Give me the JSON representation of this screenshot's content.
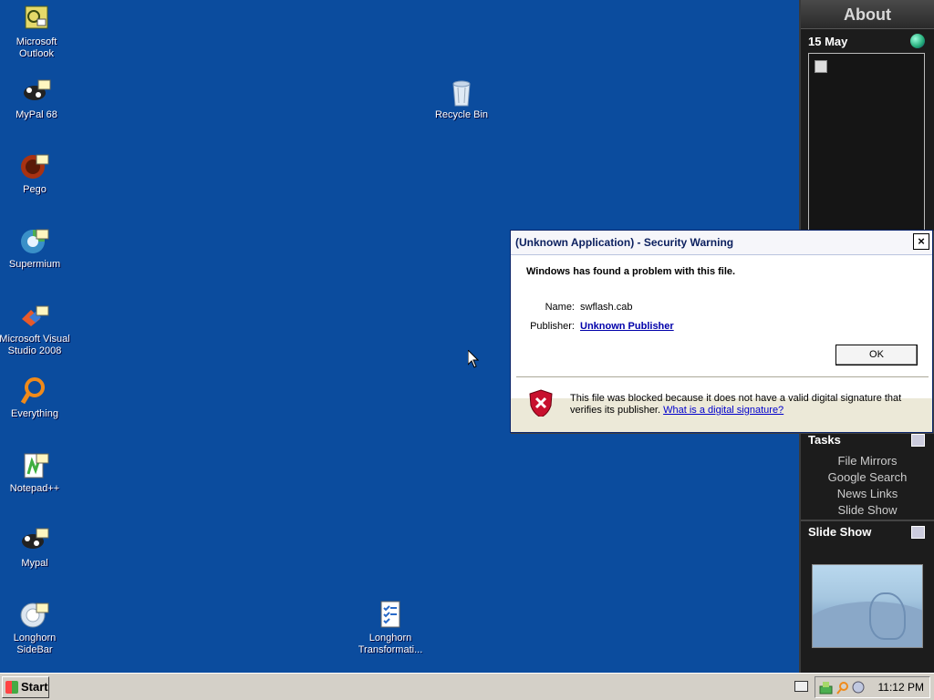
{
  "desktop": {
    "icons": [
      {
        "label": "Microsoft Outlook"
      },
      {
        "label": "MyPal 68"
      },
      {
        "label": "Pego"
      },
      {
        "label": "Supermium"
      },
      {
        "label": "Microsoft Visual Studio 2008"
      },
      {
        "label": "Everything"
      },
      {
        "label": "Notepad++"
      },
      {
        "label": "Mypal"
      },
      {
        "label": "Longhorn SideBar"
      },
      {
        "label": "Recycle Bin"
      },
      {
        "label": "Longhorn Transformati..."
      }
    ]
  },
  "sidebar": {
    "about_label": "About",
    "date": "15 May",
    "tasks": {
      "title": "Tasks",
      "items": [
        "File Mirrors",
        "Google Search",
        "News Links",
        "Slide Show"
      ]
    },
    "slideshow": {
      "title": "Slide Show"
    }
  },
  "dialog": {
    "title": "(Unknown Application) - Security Warning",
    "close_label": "×",
    "warning": "Windows has found a problem with this file.",
    "name_key": "Name:",
    "name_value": "swflash.cab",
    "publisher_key": "Publisher:",
    "publisher_value": "Unknown Publisher",
    "ok_label": "OK",
    "footer_text": "This file was blocked because it does not have a valid digital signature that verifies its publisher.",
    "footer_link": "What is a digital signature?"
  },
  "taskbar": {
    "start_label": "Start",
    "clock": "11:12 PM"
  },
  "icons": {
    "close": "close-icon",
    "shield": "shield-error-icon",
    "globe": "globe-icon",
    "start": "windows-flag-icon"
  },
  "colors": {
    "desktop_bg": "#0b4c9e",
    "sidebar_bg": "#1c1c1c",
    "link": "#0000aa"
  }
}
